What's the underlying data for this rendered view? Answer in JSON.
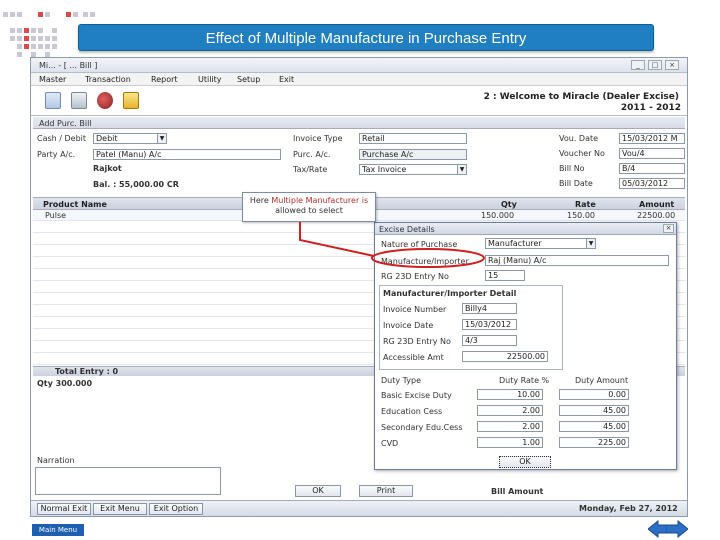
{
  "slide": {
    "title": "Effect of Multiple Manufacture in Purchase Entry",
    "main_menu_label": "Main Menu"
  },
  "app": {
    "window_title": "Mi... - [ ... Bill ]",
    "menu": [
      "Master",
      "Transaction",
      "Report",
      "Utility",
      "Setup",
      "Exit"
    ],
    "welcome": "2 : Welcome to Miracle (Dealer Excise)",
    "year": "2011 - 2012",
    "form_title": "Add Purc. Bill"
  },
  "form": {
    "cash_debit_label": "Cash / Debit",
    "cash_debit_value": "Debit",
    "party_label": "Party A/c.",
    "party_value": "Patel (Manu) A/c",
    "city": "Rajkot",
    "balance": "Bal. : 55,000.00 CR",
    "invoice_type_label": "Invoice Type",
    "invoice_type_value": "Retail",
    "purc_ac_label": "Purc. A/c.",
    "purc_ac_value": "Purchase A/c",
    "tax_rate_label": "Tax/Rate",
    "tax_rate_value": "Tax Invoice",
    "vou_date_label": "Vou. Date",
    "vou_date_value": "15/03/2012 M",
    "voucher_no_label": "Voucher No",
    "voucher_no_value": "Vou/4",
    "bill_no_label": "Bill No",
    "bill_no_value": "B/4",
    "bill_date_label": "Bill Date",
    "bill_date_value": "05/03/2012"
  },
  "grid": {
    "headers": {
      "product": "Product Name",
      "qty": "Qty",
      "rate": "Rate",
      "amount": "Amount"
    },
    "row": {
      "product": "Pulse",
      "qty": "150.000",
      "rate": "150.00",
      "amount": "22500.00"
    },
    "total_entry": "Total Entry : 0",
    "qty_total": "Qty   300.000"
  },
  "footer": {
    "narration_label": "Narration",
    "buttons": [
      "Normal Exit",
      "Exit Menu",
      "Exit Option"
    ],
    "ok": "OK",
    "print": "Print",
    "bill_amount_label": "Bill Amount",
    "datetime": "Monday, Feb 27, 2012"
  },
  "callout": {
    "line1_pre": "Here ",
    "line1_hl": "Multiple Manufacturer is",
    "line2": "allowed to select"
  },
  "excise": {
    "title": "Excise Details",
    "nature_label": "Nature of Purchase",
    "nature_value": "Manufacturer",
    "mfr_label": "Manufacture/Importer",
    "mfr_value": "Raj (Manu) A/c",
    "rg23d_label": "RG 23D Entry No",
    "rg23d_value": "15",
    "detail_title": "Manufacturer/Importer Detail",
    "inv_no_label": "Invoice Number",
    "inv_no_value": "Billy4",
    "inv_date_label": "Invoice Date",
    "inv_date_value": "15/03/2012",
    "rg23d_no_label": "RG 23D Entry No",
    "rg23d_no_value": "4/3",
    "assess_label": "Accessible Amt",
    "assess_value": "22500.00",
    "duty_head": {
      "type": "Duty Type",
      "rate": "Duty Rate %",
      "amount": "Duty Amount"
    },
    "duties": [
      {
        "name": "Basic Excise Duty",
        "rate": "10.00",
        "amount": "0.00"
      },
      {
        "name": "Education Cess",
        "rate": "2.00",
        "amount": "45.00"
      },
      {
        "name": "Secondary Edu.Cess",
        "rate": "2.00",
        "amount": "45.00"
      },
      {
        "name": "CVD",
        "rate": "1.00",
        "amount": "225.00"
      }
    ],
    "ok_label": "OK"
  }
}
